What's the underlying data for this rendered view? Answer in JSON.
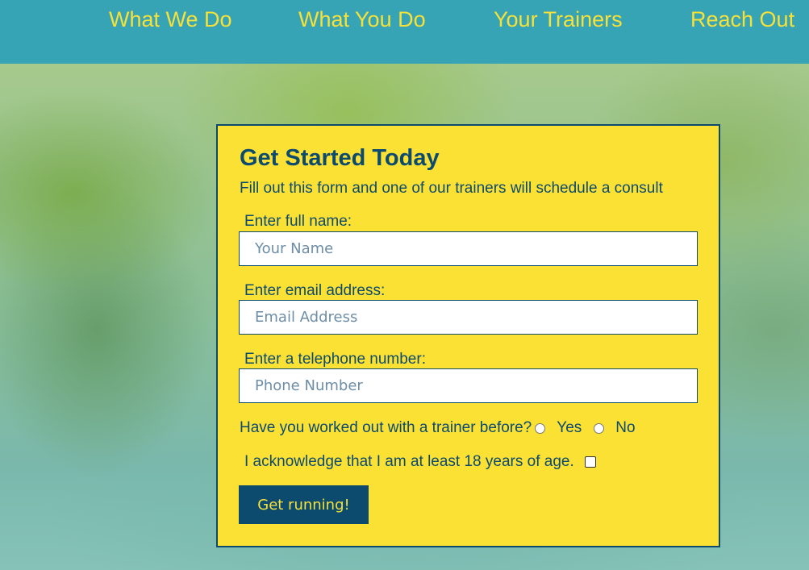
{
  "nav": {
    "items": [
      {
        "label": "What We Do"
      },
      {
        "label": "What You Do"
      },
      {
        "label": "Your Trainers"
      },
      {
        "label": "Reach Out"
      }
    ]
  },
  "form": {
    "title": "Get Started Today",
    "subtitle": "Fill out this form and one of our trainers will schedule a consult",
    "name_label": "Enter full name:",
    "name_placeholder": "Your Name",
    "name_value": "",
    "email_label": "Enter email address:",
    "email_placeholder": "Email Address",
    "email_value": "",
    "phone_label": "Enter a telephone number:",
    "phone_placeholder": "Phone Number",
    "phone_value": "",
    "trainer_question": "Have you worked out with a trainer before?",
    "yes_label": "Yes",
    "no_label": "No",
    "age_ack": "I acknowledge that I am at least 18 years of age.",
    "submit_label": "Get running!"
  },
  "colors": {
    "nav_background": "#36a4b4",
    "nav_text": "#f6e13a",
    "card_background": "#fce135",
    "primary_dark": "#0c4a6e",
    "button_text": "#f6e13a"
  }
}
